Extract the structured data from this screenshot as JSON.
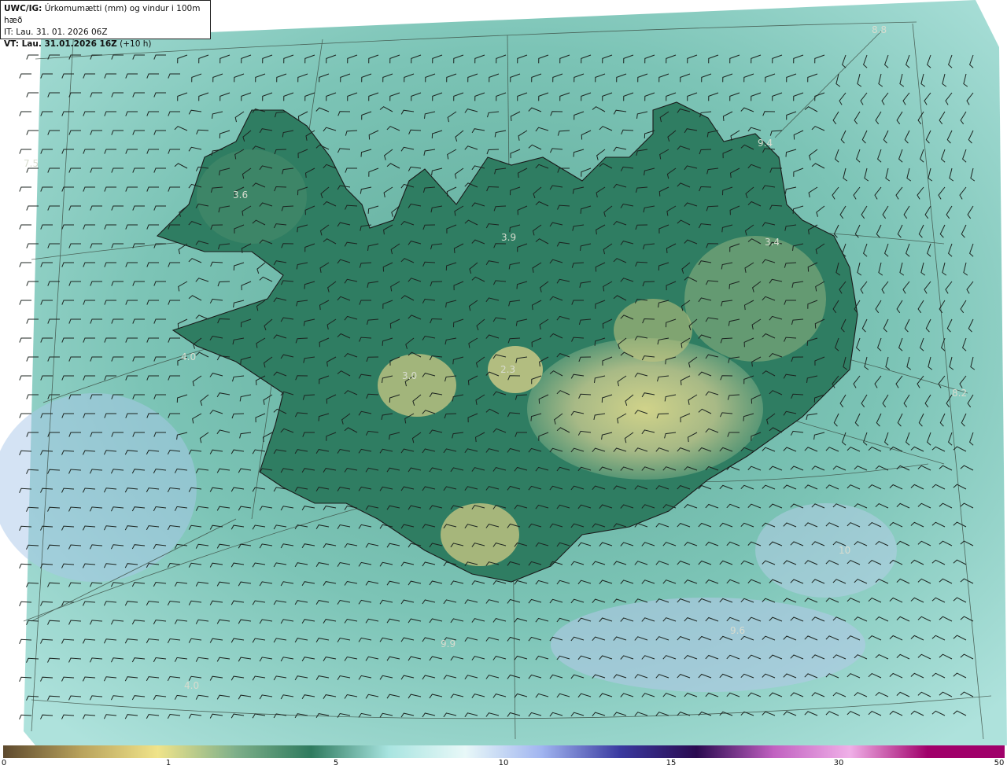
{
  "header": {
    "line1_bold": "UWC/IG:",
    "line1_rest": " Úrkomumætti (mm) og vindur i 100m hæð",
    "line2": "IT: Lau. 31. 01. 2026 06Z",
    "line3_bold": "VT: Lau. 31.01.2026 16Z",
    "line3_rest": " (+10 h)"
  },
  "map_labels": [
    {
      "text": "7.5"
    },
    {
      "text": "3.6"
    },
    {
      "text": "3.9"
    },
    {
      "text": "3.4"
    },
    {
      "text": "4.0"
    },
    {
      "text": "3.0"
    },
    {
      "text": "2.3"
    },
    {
      "text": "9.4"
    },
    {
      "text": "8.8"
    },
    {
      "text": "9.9"
    },
    {
      "text": "4.0"
    },
    {
      "text": "9.6"
    },
    {
      "text": "8.2"
    },
    {
      "text": "10"
    }
  ],
  "colorbar": {
    "ticks": [
      "0",
      "1",
      "5",
      "10",
      "15",
      "30",
      "50"
    ],
    "colors": [
      "#5e4a2e",
      "#b8a25c",
      "#f0e48a",
      "#7fb08a",
      "#2e7a5e",
      "#a8e4e0",
      "#e8f8f8",
      "#a0b4f0",
      "#3a3aa0",
      "#2a0a50",
      "#c060c0",
      "#f0b0e8",
      "#a0006a"
    ]
  }
}
